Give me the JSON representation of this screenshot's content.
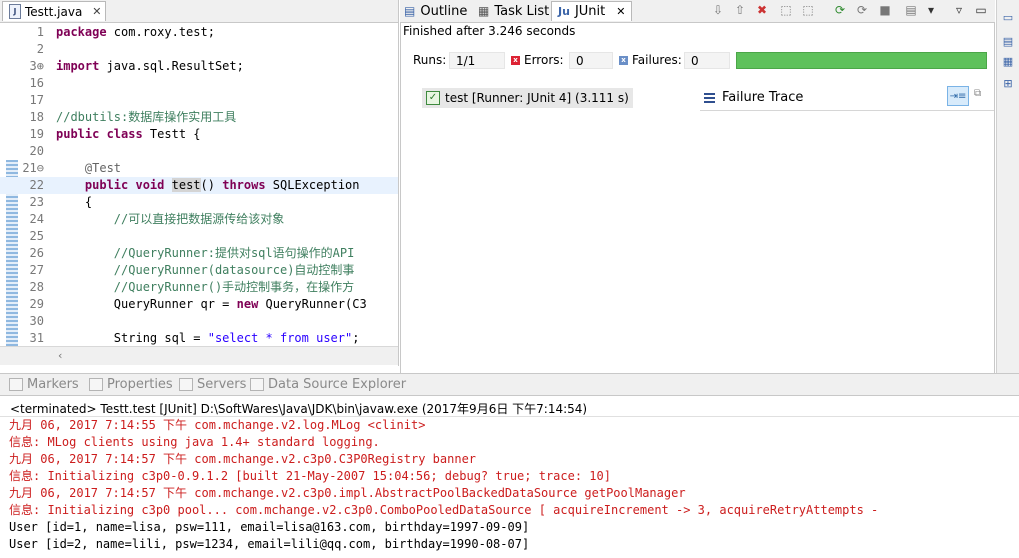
{
  "editor": {
    "tab_label": "Testt.java",
    "lines": [
      {
        "num": "1",
        "text": "package com.roxy.test;"
      },
      {
        "num": "2",
        "text": ""
      },
      {
        "num": "3⊕",
        "text": "import java.sql.ResultSet;"
      },
      {
        "num": "16",
        "text": ""
      },
      {
        "num": "17",
        "text": ""
      },
      {
        "num": "18",
        "text": "//dbutils:数据库操作实用工具"
      },
      {
        "num": "19",
        "text": "public class Testt {"
      },
      {
        "num": "20",
        "text": ""
      },
      {
        "num": "21⊖",
        "text": "    @Test"
      },
      {
        "num": "22",
        "text": "    public void test() throws SQLException"
      },
      {
        "num": "23",
        "text": "    {"
      },
      {
        "num": "24",
        "text": "        //可以直接把数据源传给该对象"
      },
      {
        "num": "25",
        "text": ""
      },
      {
        "num": "26",
        "text": "        //QueryRunner:提供对sql语句操作的API"
      },
      {
        "num": "27",
        "text": "        //QueryRunner(datasource)自动控制事"
      },
      {
        "num": "28",
        "text": "        //QueryRunner()手动控制事务，在操作方"
      },
      {
        "num": "29",
        "text": "        QueryRunner qr = new QueryRunner(C3"
      },
      {
        "num": "30",
        "text": ""
      },
      {
        "num": "31",
        "text": "        String sql = \"select * from user\";"
      }
    ]
  },
  "junit_view": {
    "tabs": [
      "Outline",
      "Task List",
      "JUnit"
    ],
    "finished_text": "Finished after 3.246 seconds",
    "runs_label": "Runs:",
    "runs_value": "1/1",
    "errors_label": "Errors:",
    "errors_value": "0",
    "failures_label": "Failures:",
    "failures_value": "0",
    "progress": 1.0,
    "progress_color": "#5ec15b",
    "test_item": "test [Runner: JUnit 4] (3.111 s)",
    "failure_trace_label": "Failure Trace"
  },
  "bottom_tabs": [
    "Markers",
    "Properties",
    "Servers",
    "Data Source Explorer"
  ],
  "console": {
    "status": "<terminated> Testt.test [JUnit] D:\\SoftWares\\Java\\JDK\\bin\\javaw.exe (2017年9月6日 下午7:14:54)",
    "lines": [
      {
        "text": "九月 06, 2017 7:14:55 下午 com.mchange.v2.log.MLog <clinit>",
        "color": "red"
      },
      {
        "text": "信息: MLog clients using java 1.4+ standard logging.",
        "color": "red"
      },
      {
        "text": "九月 06, 2017 7:14:57 下午 com.mchange.v2.c3p0.C3P0Registry banner",
        "color": "red"
      },
      {
        "text": "信息: Initializing c3p0-0.9.1.2 [built 21-May-2007 15:04:56; debug? true; trace: 10]",
        "color": "red"
      },
      {
        "text": "九月 06, 2017 7:14:57 下午 com.mchange.v2.c3p0.impl.AbstractPoolBackedDataSource getPoolManager",
        "color": "red"
      },
      {
        "text": "信息: Initializing c3p0 pool... com.mchange.v2.c3p0.ComboPooledDataSource [ acquireIncrement -> 3, acquireRetryAttempts -",
        "color": "red"
      },
      {
        "text": "User [id=1, name=lisa, psw=111, email=lisa@163.com, birthday=1997-09-09]",
        "color": "black"
      },
      {
        "text": "User [id=2, name=lili, psw=1234, email=lili@qq.com, birthday=1990-08-07]",
        "color": "black"
      }
    ]
  }
}
